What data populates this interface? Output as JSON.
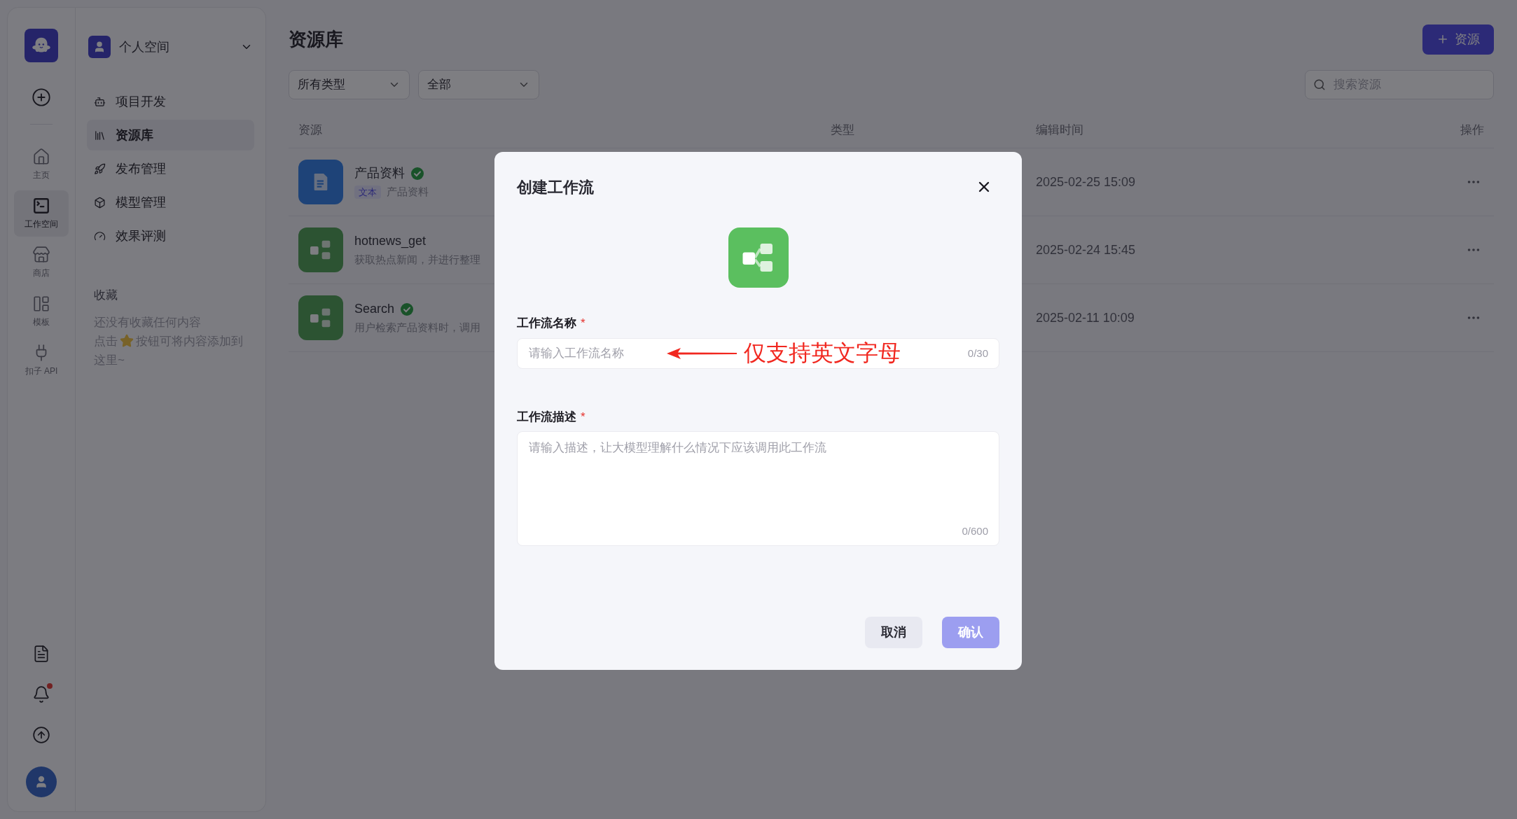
{
  "rail": {
    "items": [
      {
        "label": "主页",
        "selected": false
      },
      {
        "label": "工作空间",
        "selected": true
      },
      {
        "label": "商店",
        "selected": false
      },
      {
        "label": "模板",
        "selected": false
      },
      {
        "label": "扣子 API",
        "selected": false
      }
    ],
    "bell_unread": true
  },
  "space": {
    "name": "个人空间"
  },
  "menu": [
    {
      "label": "项目开发",
      "selected": false
    },
    {
      "label": "资源库",
      "selected": true
    },
    {
      "label": "发布管理",
      "selected": false
    },
    {
      "label": "模型管理",
      "selected": false
    },
    {
      "label": "效果评测",
      "selected": false
    }
  ],
  "favorites": {
    "title": "收藏",
    "empty_text": "还没有收藏任何内容",
    "hint_before": "点击",
    "hint_after": "按钮可将内容添加到",
    "hint_end": "这里~"
  },
  "page": {
    "title": "资源库",
    "add_button": "资源",
    "filters": [
      "所有类型",
      "全部"
    ],
    "search": {
      "placeholder": "搜索资源"
    }
  },
  "table": {
    "columns": [
      "资源",
      "类型",
      "编辑时间",
      "操作"
    ],
    "rows": [
      {
        "kind": "document",
        "name": "产品资料",
        "verified": true,
        "tag": "文本",
        "description": "产品资料",
        "edited": "2025-02-25 15:09"
      },
      {
        "kind": "workflow",
        "name": "hotnews_get",
        "verified": false,
        "description": "获取热点新闻，并进行整理",
        "edited": "2025-02-24 15:45"
      },
      {
        "kind": "workflow",
        "name": "Search",
        "verified": true,
        "description": "用户检索产品资料时，调用",
        "edited": "2025-02-11 10:09"
      }
    ]
  },
  "dialog": {
    "title": "创建工作流",
    "name_field": {
      "label": "工作流名称",
      "required_mark": "*",
      "placeholder": "请输入工作流名称",
      "counter": "0/30"
    },
    "annotation": {
      "text": "仅支持英文字母"
    },
    "description_field": {
      "label": "工作流描述",
      "required_mark": "*",
      "placeholder": "请输入描述，让大模型理解什么情况下应该调用此工作流",
      "counter": "0/600"
    },
    "buttons": [
      {
        "label": "取消",
        "kind": "secondary",
        "disabled": false
      },
      {
        "label": "确认",
        "kind": "primary",
        "disabled": true
      }
    ]
  }
}
